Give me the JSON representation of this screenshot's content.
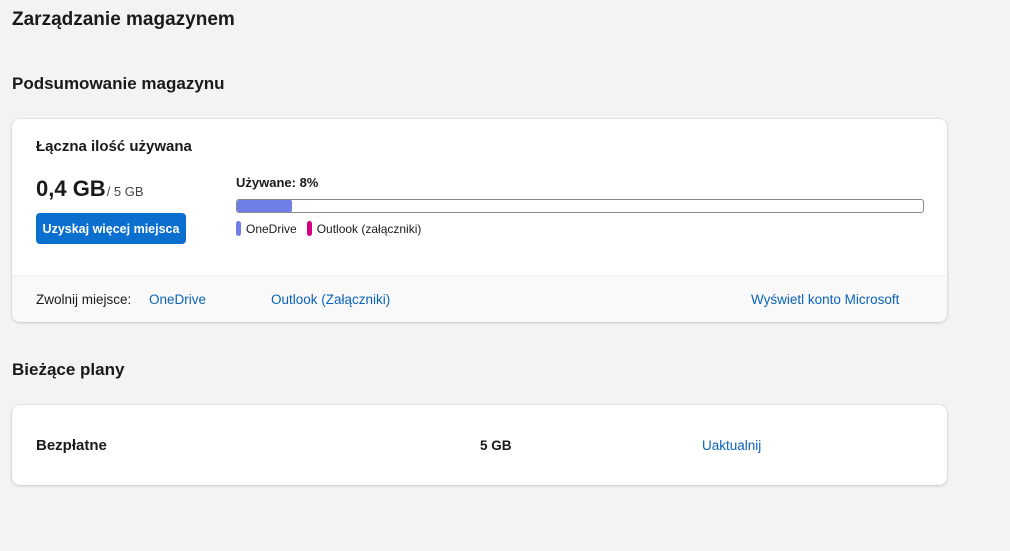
{
  "page": {
    "title": "Zarządzanie magazynem"
  },
  "summary": {
    "section_title": "Podsumowanie magazynu",
    "card_heading": "Łączna ilość używana",
    "used_amount": "0,4 GB",
    "total_amount": "/ 5 GB",
    "get_more_button": "Uzyskaj więcej miejsca",
    "used_label": "Używane: 8%",
    "used_fraction": 0.08,
    "legend": [
      {
        "label": "OneDrive",
        "color": "#6f7de8"
      },
      {
        "label": "Outlook (załączniki)",
        "color": "#d4007f"
      }
    ],
    "footer": {
      "free_label": "Zwolnij miejsce:",
      "onedrive_link": "OneDrive",
      "outlook_link": "Outlook (Załączniki)",
      "account_link": "Wyświetl konto Microsoft"
    }
  },
  "plans": {
    "section_title": "Bieżące plany",
    "plan_name": "Bezpłatne",
    "plan_size": "5 GB",
    "upgrade_link": "Uaktualnij"
  },
  "colors": {
    "accent": "#0a6fce",
    "link": "#0a63b8",
    "progress": "#6f7de8",
    "outlook": "#d4007f"
  }
}
